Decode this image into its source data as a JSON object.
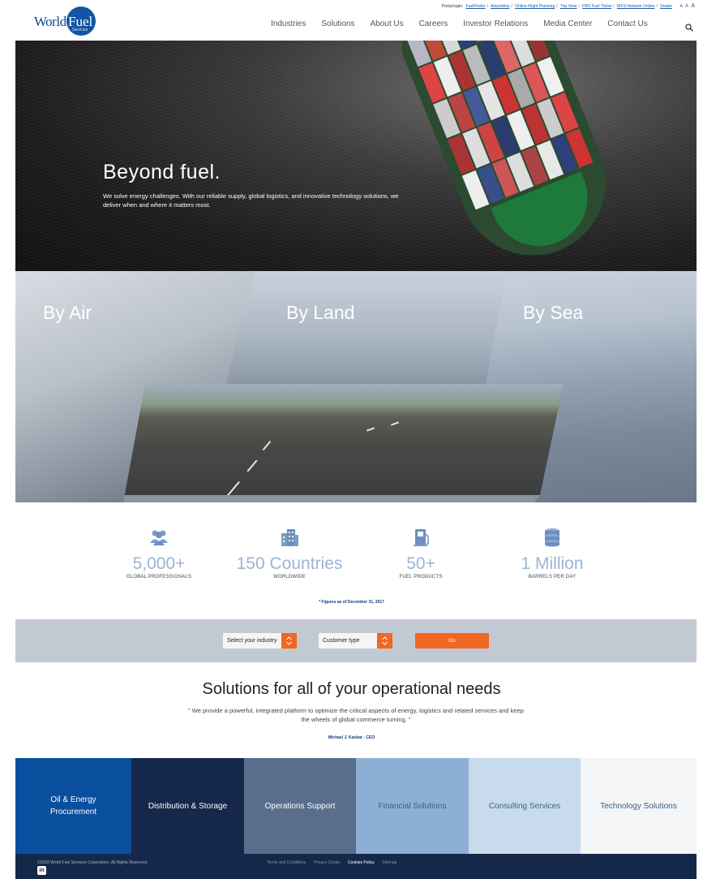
{
  "header": {
    "portal_label": "Portal login:",
    "portal_links": [
      "FuelFinder",
      "Airportskis",
      "Online Flight Planning",
      "Trip View",
      "FBO Fuel Ticket",
      "WFS Network Online",
      "Dealer"
    ],
    "font_sizes": [
      "A",
      "A",
      "A"
    ],
    "logo_world": "World",
    "logo_fuel": "Fuel",
    "logo_services": "Services",
    "nav": [
      "Industries",
      "Solutions",
      "About Us",
      "Careers",
      "Investor Relations",
      "Media Center",
      "Contact Us"
    ]
  },
  "hero": {
    "title": "Beyond fuel.",
    "subtitle": "We solve energy challenges. With our reliable supply, global logistics, and innovative technology solutions, we deliver when and where it matters most."
  },
  "transport": {
    "air": "By Air",
    "land": "By Land",
    "sea": "By Sea"
  },
  "stats": [
    {
      "number": "5,000+",
      "caption": "GLOBAL PROFESSIONALS",
      "icon": "people-icon"
    },
    {
      "number": "150 Countries",
      "caption": "WORLDWIDE",
      "icon": "building-icon"
    },
    {
      "number": "50+",
      "caption": "FUEL PRODUCTS",
      "icon": "fuel-pump-icon"
    },
    {
      "number": "1 Million",
      "caption": "BARRELS PER DAY",
      "icon": "barrels-icon"
    }
  ],
  "figures_note": "* Figures as of December 31, 2017",
  "filter": {
    "industry_value": "Select your industry",
    "customer_value": "Customer type",
    "go_label": "Go",
    "accent": "#f26722"
  },
  "solutions": {
    "title": "Solutions for all of your operational needs",
    "quote": "\" We provide a powerful, integrated platform to optimize the critical aspects of energy, logistics and related services and keep the wheels of global commerce turning. \"",
    "author": "Michael J. Kasbar - CEO",
    "tiles": [
      {
        "label": "Oil & Energy Procurement",
        "bg": "#0a4f9e",
        "fg": "#ffffff"
      },
      {
        "label": "Distribution & Storage",
        "bg": "#15274a",
        "fg": "#ffffff"
      },
      {
        "label": "Operations Support",
        "bg": "#596e8c",
        "fg": "#ffffff"
      },
      {
        "label": "Financial Solutions",
        "bg": "#8eafd4",
        "fg": "#3f5e86"
      },
      {
        "label": "Consulting Services",
        "bg": "#c7dbec",
        "fg": "#3f5e86"
      },
      {
        "label": "Technology Solutions",
        "bg": "#f3f5f7",
        "fg": "#3f5e86"
      }
    ]
  },
  "footer": {
    "copyright": "©2018 World Fuel Services Corporation. All Rights Reserved.",
    "links": [
      "Terms and Conditions",
      "Privacy Center",
      "Cookies Policy",
      "Sitemap"
    ],
    "linkedin_label": "in"
  }
}
